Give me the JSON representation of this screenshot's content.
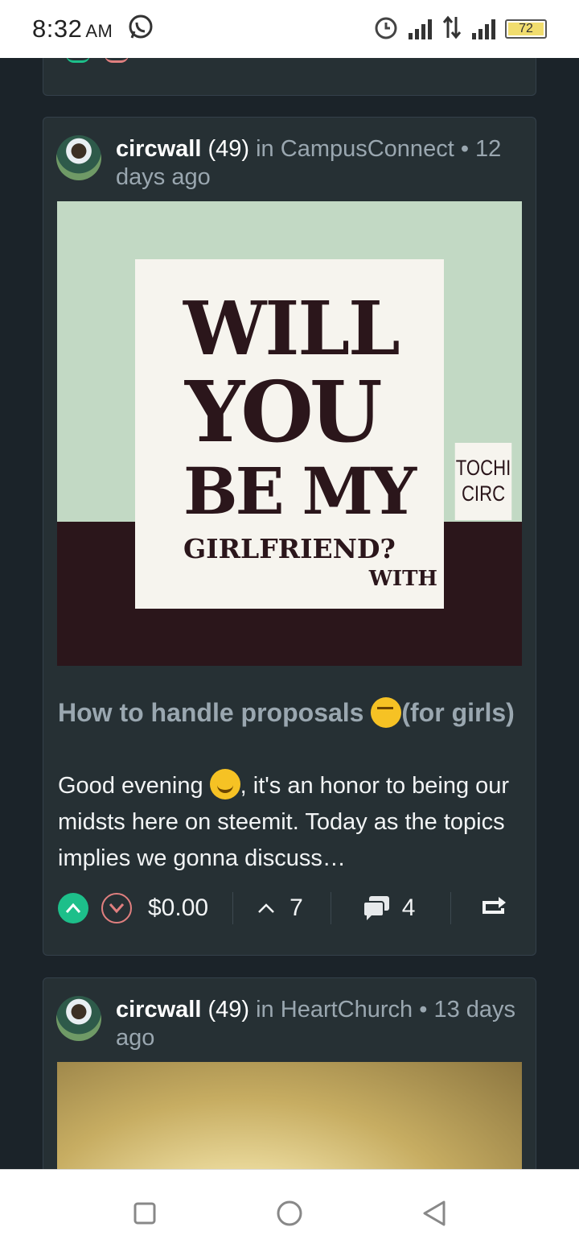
{
  "status_bar": {
    "time": "8:32",
    "ampm": "AM",
    "battery": "72"
  },
  "posts": [
    {
      "author": "circwall",
      "reputation": "(49)",
      "community_prefix": "in",
      "community": "CampusConnect",
      "age": "12 days ago",
      "image": {
        "line1": "WILL",
        "line2": "YOU",
        "line3": "BE MY",
        "line4": "GIRLFRIEND?",
        "line5": "WITH",
        "tag_line1": "TOCHI",
        "tag_line2": "CIRC"
      },
      "title_start": "How to handle proposals ",
      "title_end": "(for girls)",
      "body_start": "Good evening ",
      "body_end": ", it's an honor to being our midsts here on steemit. Today as the topics implies we gonna discuss…",
      "payout": "$0.00",
      "votes": "7",
      "comments": "4"
    },
    {
      "author": "circwall",
      "reputation": "(49)",
      "community_prefix": "in",
      "community": "HeartChurch",
      "age": "13 days ago"
    }
  ]
}
